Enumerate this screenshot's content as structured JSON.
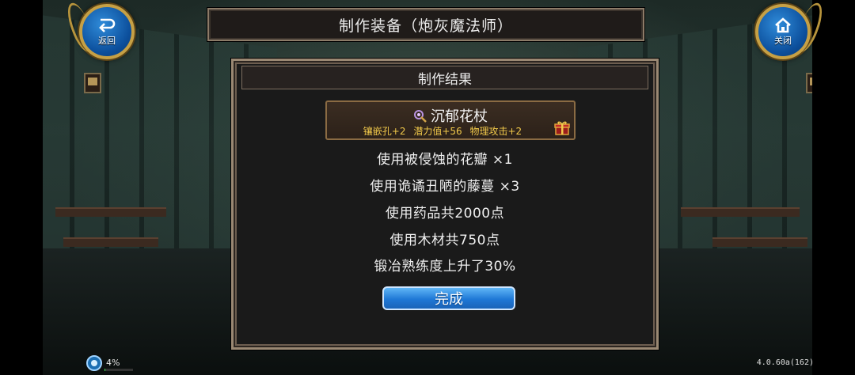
{
  "header": {
    "title": "制作装备（炮灰魔法师）"
  },
  "nav": {
    "back_label": "返回",
    "close_label": "关闭"
  },
  "dialog": {
    "title": "制作结果",
    "item": {
      "name": "沉郁花杖",
      "stats": [
        "镶嵌孔+2",
        "潜力值+56",
        "物理攻击+2"
      ]
    },
    "results": [
      "使用被侵蚀的花瓣 ×1",
      "使用诡谲丑陋的藤蔓 ×3",
      "使用药品共2000点",
      "使用木材共750点",
      "锻冶熟练度上升了30%"
    ],
    "confirm_label": "完成"
  },
  "hud": {
    "percent": "4%",
    "progress": 0.04,
    "version": "4.0.60a(162)"
  },
  "colors": {
    "stat_gold": "#f0c84a",
    "button_blue": "#1f78d6",
    "frame": "#9a8873"
  }
}
